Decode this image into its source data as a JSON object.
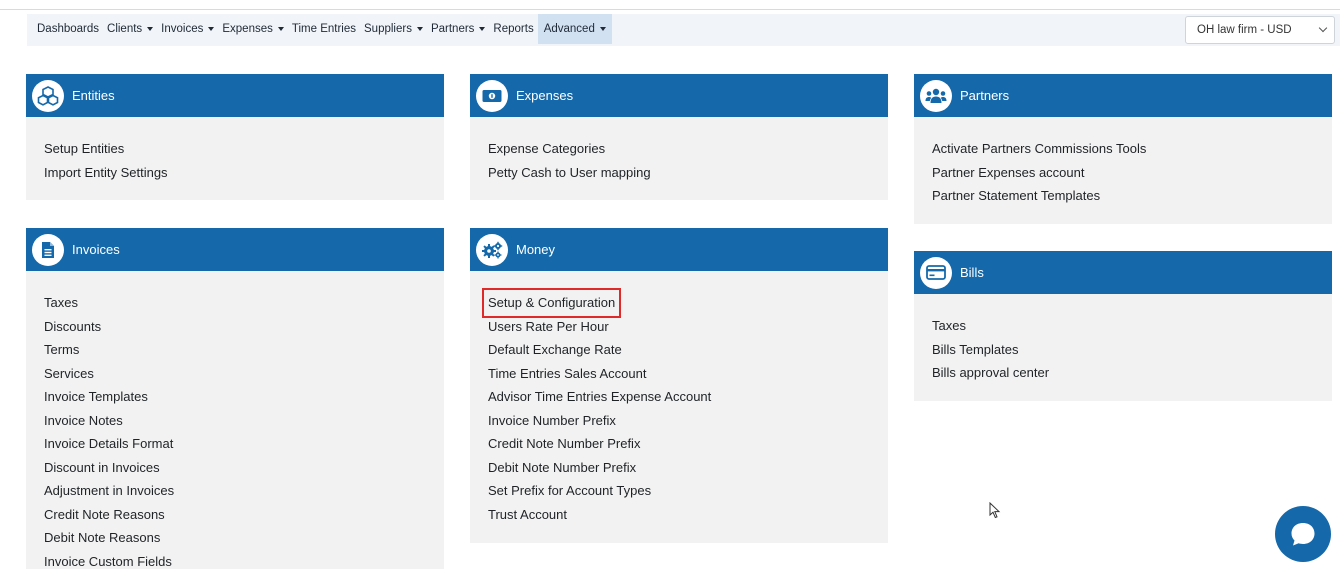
{
  "nav": {
    "items": [
      {
        "label": "Dashboards",
        "dropdown": false,
        "active": false
      },
      {
        "label": "Clients",
        "dropdown": true,
        "active": false
      },
      {
        "label": "Invoices",
        "dropdown": true,
        "active": false
      },
      {
        "label": "Expenses",
        "dropdown": true,
        "active": false
      },
      {
        "label": "Time Entries",
        "dropdown": false,
        "active": false
      },
      {
        "label": "Suppliers",
        "dropdown": true,
        "active": false
      },
      {
        "label": "Partners",
        "dropdown": true,
        "active": false
      },
      {
        "label": "Reports",
        "dropdown": false,
        "active": false
      },
      {
        "label": "Advanced",
        "dropdown": true,
        "active": true
      }
    ],
    "company_select": "OH law firm - USD"
  },
  "cards": {
    "entities": {
      "title": "Entities",
      "icon": "cubes-icon",
      "links": [
        "Setup Entities",
        "Import Entity Settings"
      ]
    },
    "expenses": {
      "title": "Expenses",
      "icon": "money-bill-icon",
      "links": [
        "Expense Categories",
        "Petty Cash to User mapping"
      ]
    },
    "partners": {
      "title": "Partners",
      "icon": "users-icon",
      "links": [
        "Activate Partners Commissions Tools",
        "Partner Expenses account",
        "Partner Statement Templates"
      ]
    },
    "invoices": {
      "title": "Invoices",
      "icon": "file-invoice-icon",
      "links": [
        "Taxes",
        "Discounts",
        "Terms",
        "Services",
        "Invoice Templates",
        "Invoice Notes",
        "Invoice Details Format",
        "Discount in Invoices",
        "Adjustment in Invoices",
        "Credit Note Reasons",
        "Debit Note Reasons",
        "Invoice Custom Fields"
      ]
    },
    "money": {
      "title": "Money",
      "icon": "cogs-icon",
      "links": [
        "Setup & Configuration",
        "Users Rate Per Hour",
        "Default Exchange Rate",
        "Time Entries Sales Account",
        "Advisor Time Entries Expense Account",
        "Invoice Number Prefix",
        "Credit Note Number Prefix",
        "Debit Note Number Prefix",
        "Set Prefix for Account Types",
        "Trust Account"
      ],
      "highlighted_link": "Setup & Configuration"
    },
    "bills": {
      "title": "Bills",
      "icon": "credit-card-icon",
      "links": [
        "Taxes",
        "Bills Templates",
        "Bills approval center"
      ]
    }
  },
  "colors": {
    "accent": "#1569aa",
    "nav_bg": "#f1f4f8",
    "active_nav": "#d2e1f2",
    "card_bg": "#f2f2f2",
    "highlight_border": "#e02a2a"
  }
}
